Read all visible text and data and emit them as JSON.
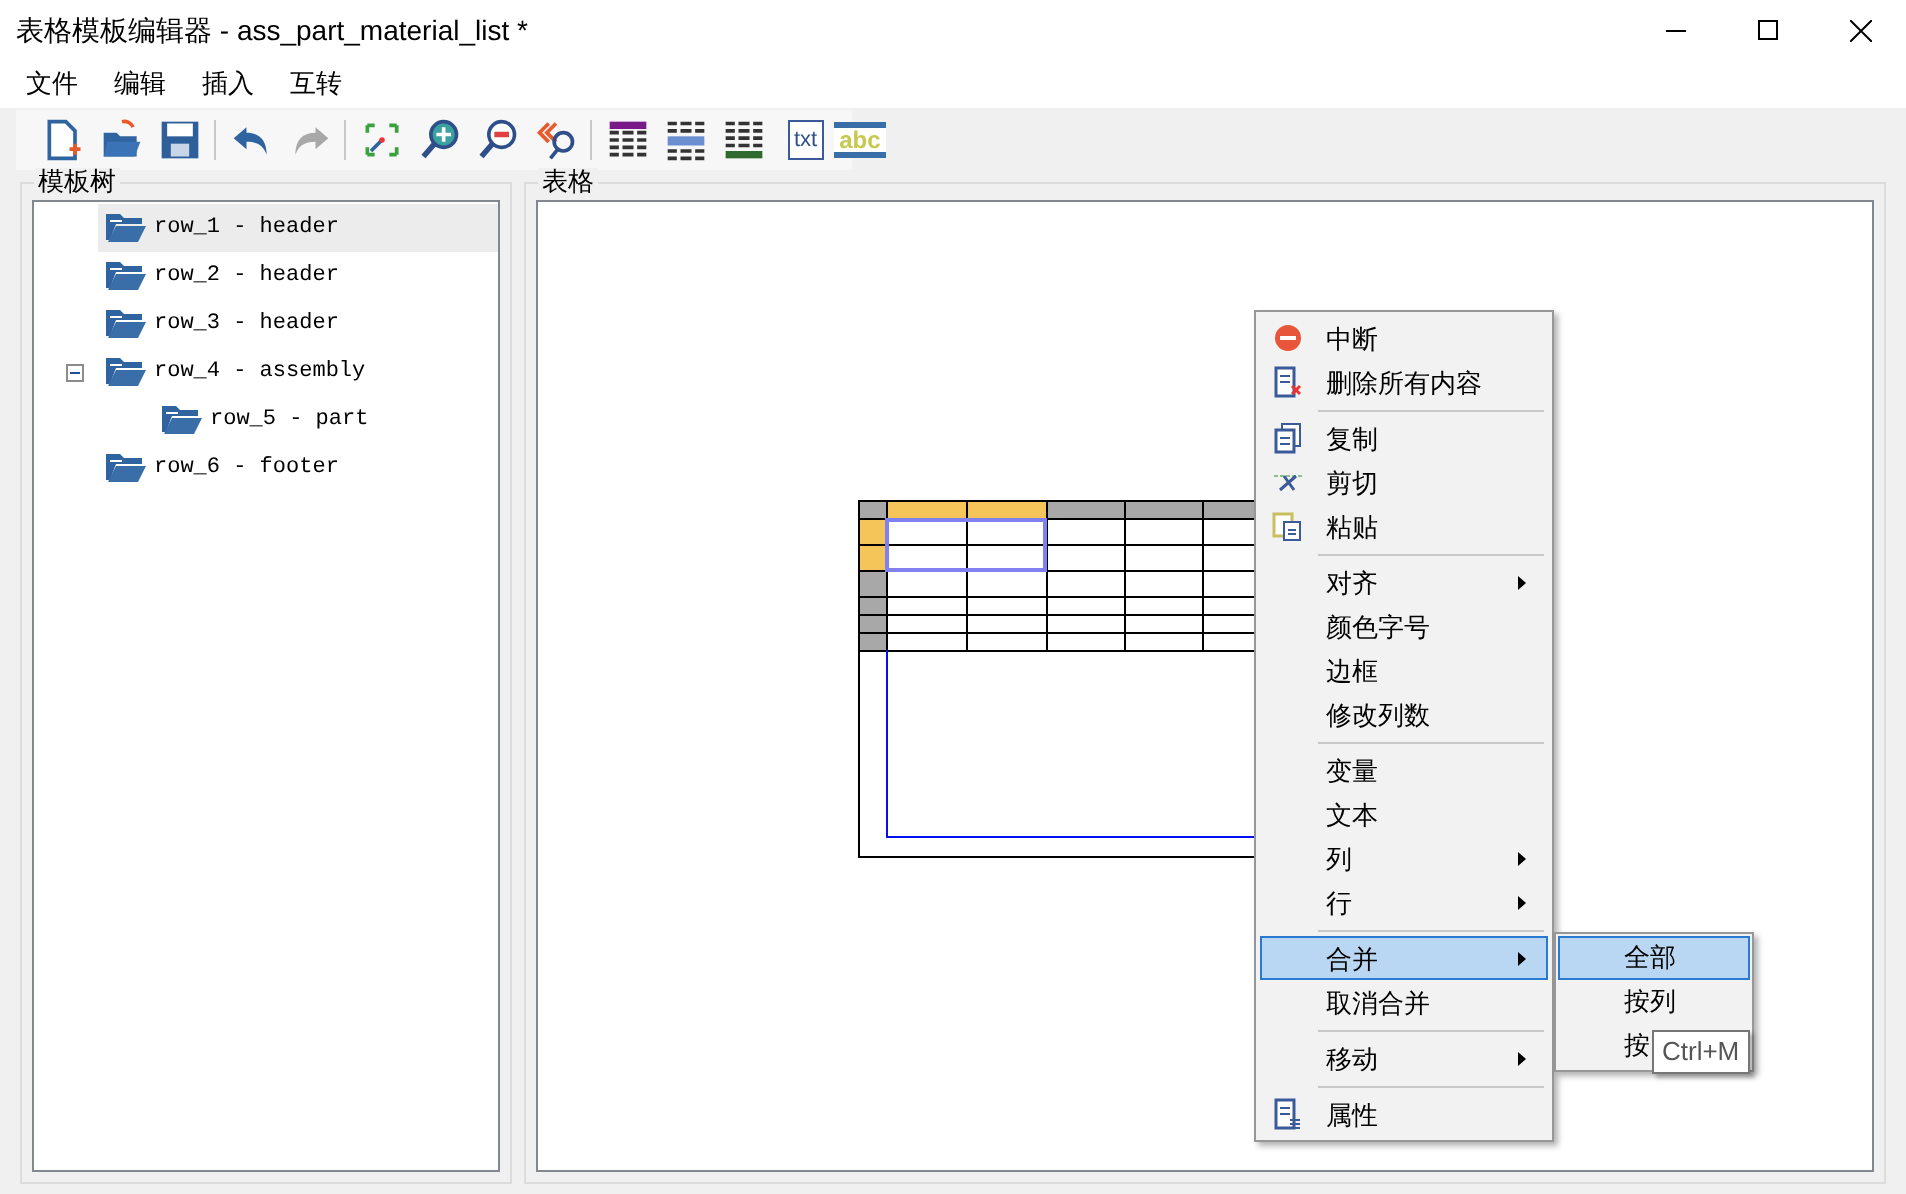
{
  "window": {
    "title": "表格模板编辑器 - ass_part_material_list *"
  },
  "menu_bar": [
    "文件",
    "编辑",
    "插入",
    "互转"
  ],
  "toolbar": {
    "text_buttons": [
      "txt",
      "abc"
    ]
  },
  "tree_panel": {
    "title": "模板树",
    "items": [
      {
        "label": "row_1 - header",
        "selected": true
      },
      {
        "label": "row_2 - header",
        "selected": false
      },
      {
        "label": "row_3 - header",
        "selected": false
      },
      {
        "label": "row_4 - assembly",
        "selected": false,
        "expanded": true,
        "children": [
          {
            "label": "row_5 - part",
            "selected": false
          }
        ]
      },
      {
        "label": "row_6 - footer",
        "selected": false
      }
    ]
  },
  "table_panel": {
    "title": "表格"
  },
  "context_menu": {
    "groups": [
      [
        {
          "label": "中断",
          "selected": false,
          "submenu": false
        },
        {
          "label": "删除所有内容",
          "selected": false,
          "submenu": false
        }
      ],
      [
        {
          "label": "复制",
          "selected": false,
          "submenu": false
        },
        {
          "label": "剪切",
          "selected": false,
          "submenu": false
        },
        {
          "label": "粘贴",
          "selected": false,
          "submenu": false
        }
      ],
      [
        {
          "label": "对齐",
          "selected": false,
          "submenu": true
        },
        {
          "label": "颜色字号",
          "selected": false,
          "submenu": false
        },
        {
          "label": "边框",
          "selected": false,
          "submenu": false
        },
        {
          "label": "修改列数",
          "selected": false,
          "submenu": false
        }
      ],
      [
        {
          "label": "变量",
          "selected": false,
          "submenu": false
        },
        {
          "label": "文本",
          "selected": false,
          "submenu": false
        },
        {
          "label": "列",
          "selected": false,
          "submenu": true
        },
        {
          "label": "行",
          "selected": false,
          "submenu": true
        }
      ],
      [
        {
          "label": "合并",
          "selected": true,
          "submenu": true
        },
        {
          "label": "取消合并",
          "selected": false,
          "submenu": false
        }
      ],
      [
        {
          "label": "移动",
          "selected": false,
          "submenu": true
        }
      ],
      [
        {
          "label": "属性",
          "selected": false,
          "submenu": false
        }
      ]
    ]
  },
  "submenu": {
    "items": [
      {
        "label": "全部",
        "selected": true
      },
      {
        "label": "按列",
        "selected": false
      },
      {
        "label": "按",
        "selected": false
      }
    ]
  },
  "tooltip": {
    "text": "Ctrl+M"
  }
}
